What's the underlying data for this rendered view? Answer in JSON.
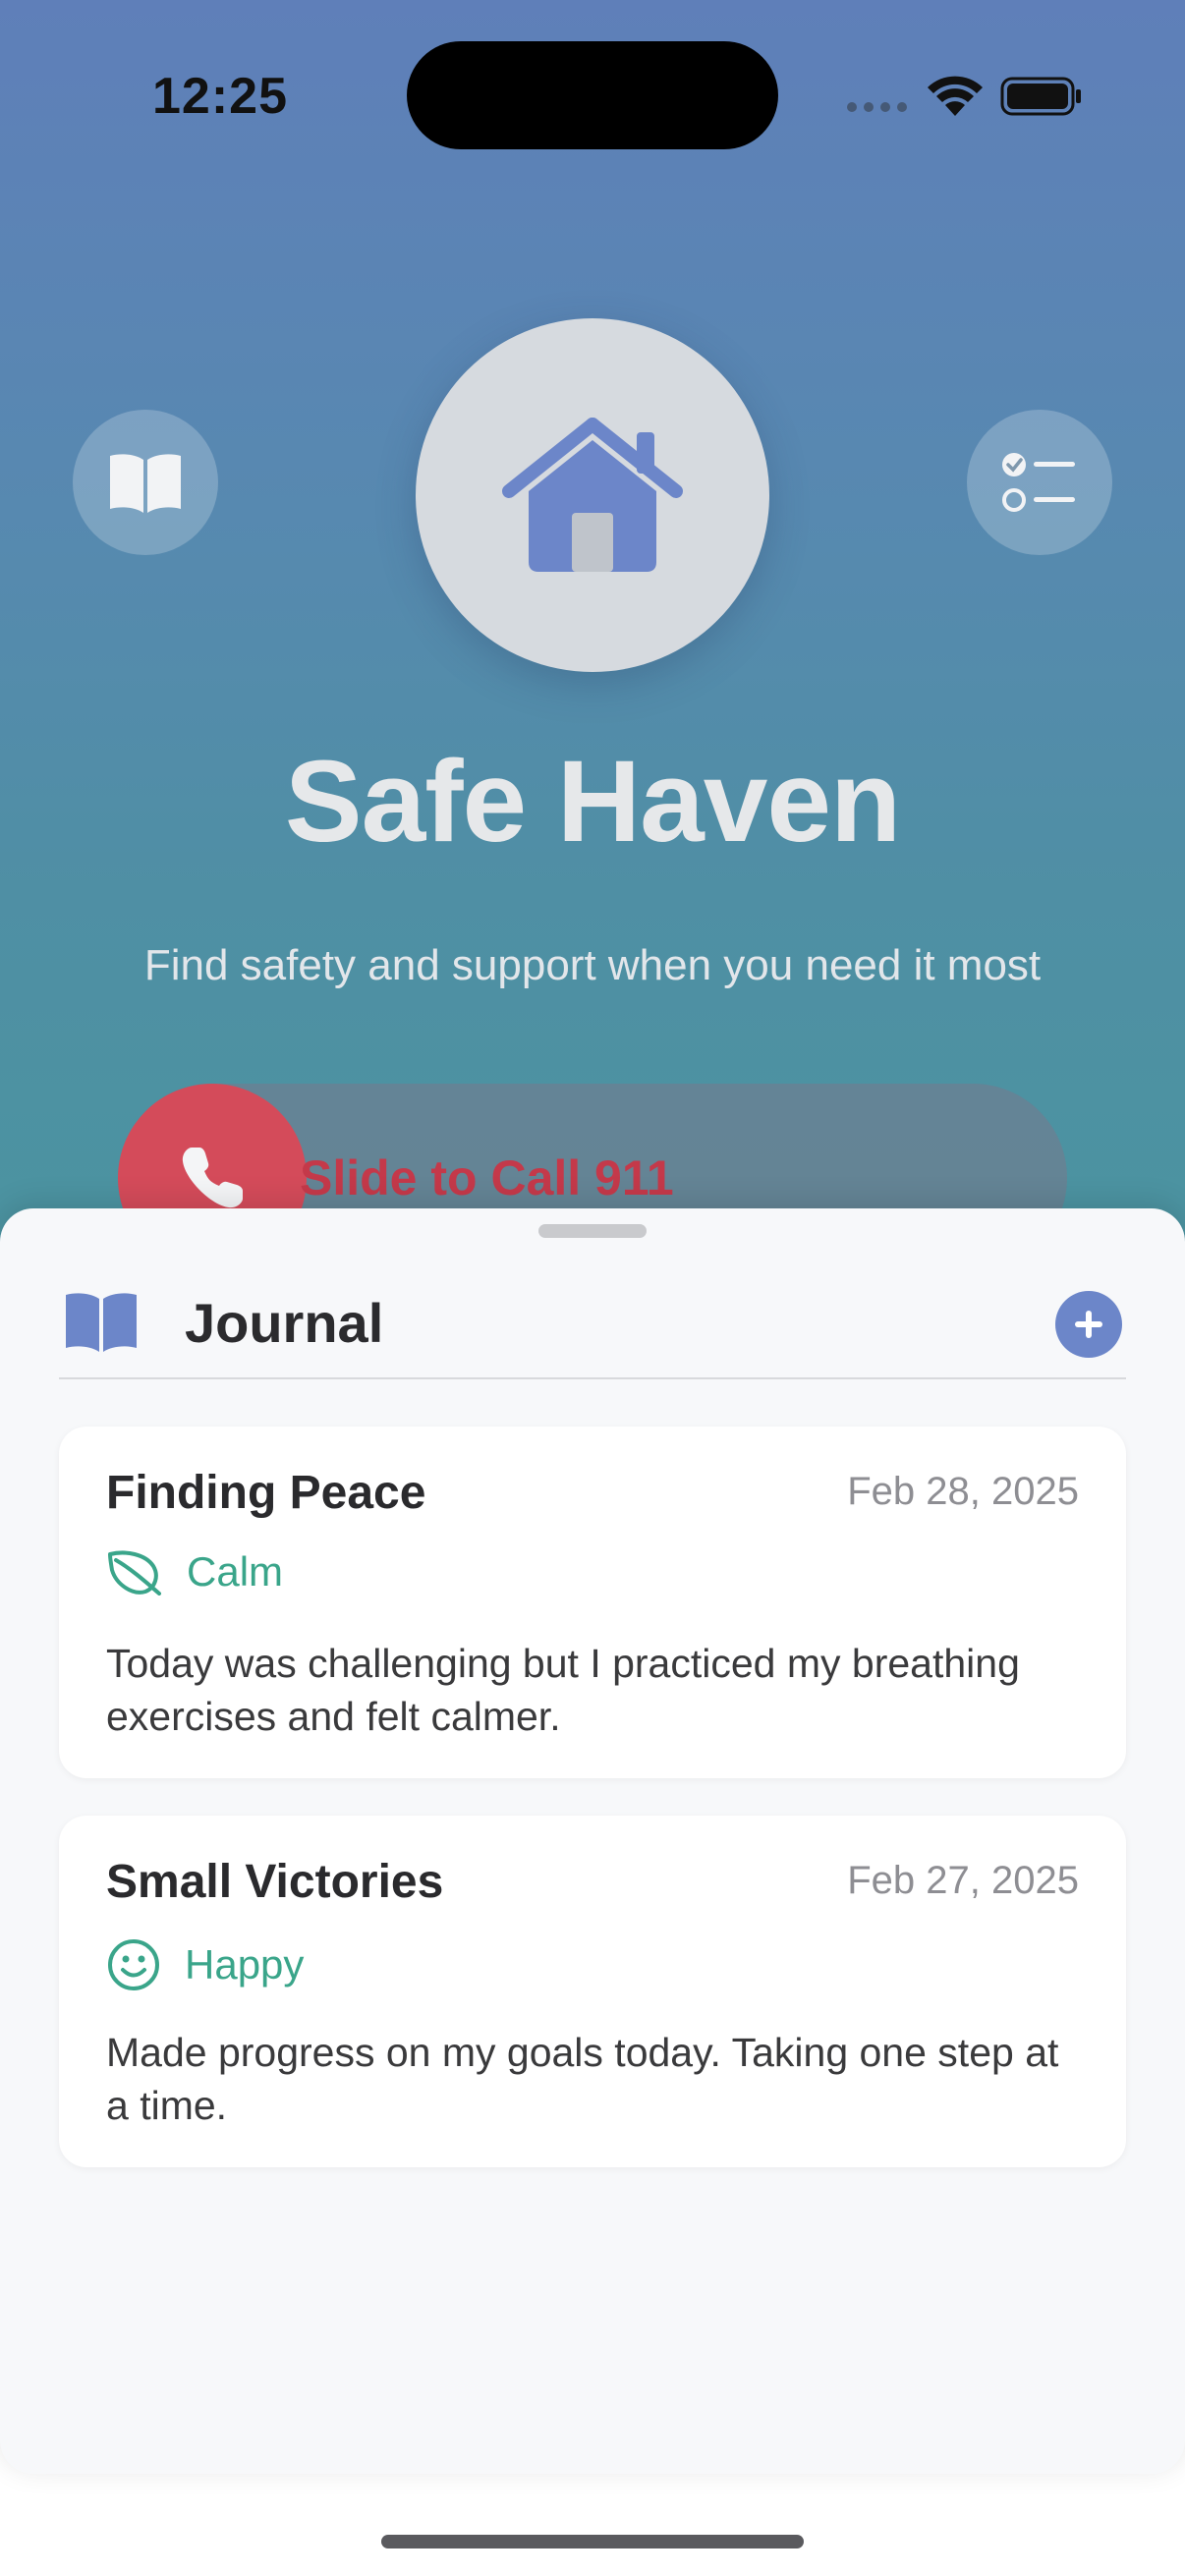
{
  "status_bar": {
    "time": "12:25"
  },
  "hero": {
    "title": "Safe Haven",
    "subtitle": "Find safety and support when you need it most",
    "left_button_icon": "book-icon",
    "center_icon": "house-icon",
    "right_button_icon": "checklist-icon"
  },
  "emergency_slider": {
    "label": "Slide to Call 911",
    "icon": "phone-icon",
    "color": "#d44b5a"
  },
  "journal": {
    "title": "Journal",
    "add_icon": "plus-icon",
    "accent": "#6c86c9",
    "entries": [
      {
        "title": "Finding Peace",
        "date": "Feb 28, 2025",
        "mood": "Calm",
        "mood_icon": "leaf-icon",
        "text": "Today was challenging but I practiced my breathing exercises and felt calmer."
      },
      {
        "title": "Small Victories",
        "date": "Feb 27, 2025",
        "mood": "Happy",
        "mood_icon": "smiley-icon",
        "text": "Made progress on my goals today. Taking one step at a time."
      }
    ]
  },
  "colors": {
    "mood_green": "#3aa58a",
    "gradient_top": "#5f7fb9",
    "gradient_bottom": "#4b94a0"
  }
}
